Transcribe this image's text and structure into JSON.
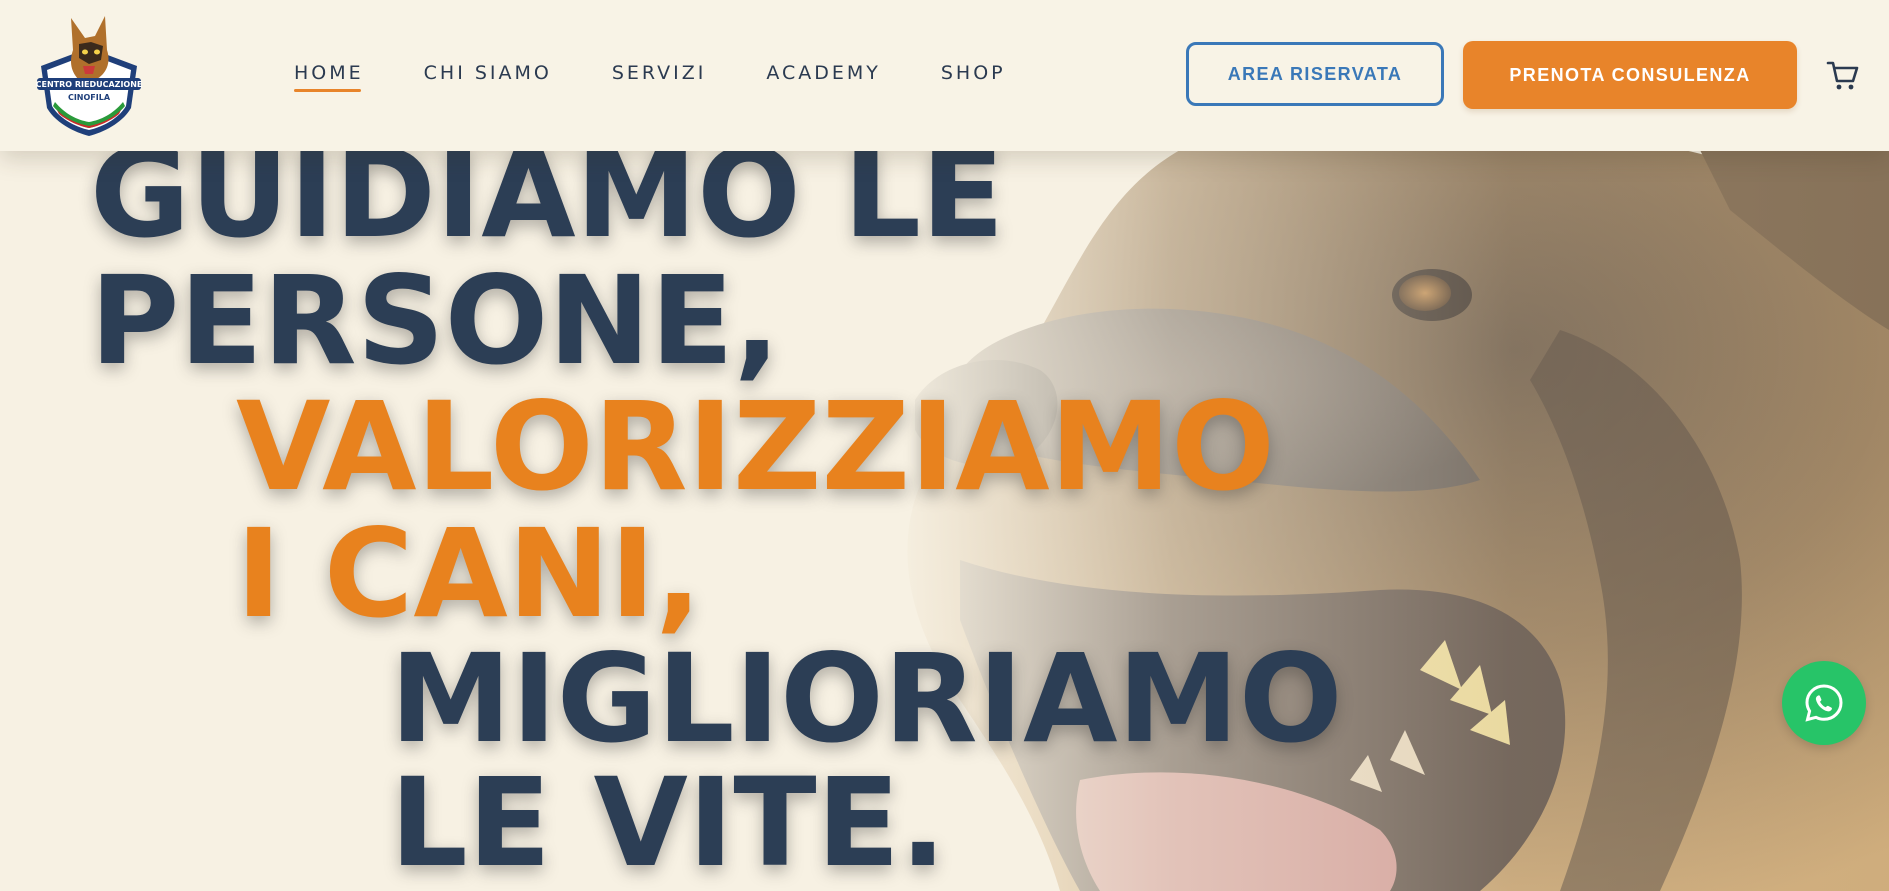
{
  "brand": {
    "logo_icon": "german-shepherd-shield-logo",
    "logo_text": "CENTRO RIEDUCAZIONE CINOFILA"
  },
  "nav": {
    "items": [
      {
        "label": "HOME",
        "active": true
      },
      {
        "label": "CHI SIAMO",
        "active": false
      },
      {
        "label": "SERVIZI",
        "active": false
      },
      {
        "label": "ACADEMY",
        "active": false
      },
      {
        "label": "SHOP",
        "active": false
      }
    ],
    "area_riservata": "AREA RISERVATA",
    "prenota": "PRENOTA CONSULENZA",
    "cart_icon": "shopping-cart-icon"
  },
  "hero": {
    "lines": [
      "GUIDIAMO LE",
      "PERSONE,",
      "VALORIZZIAMO",
      "I CANI,",
      "MIGLIORIAMO",
      "LE VITE."
    ],
    "background_icon": "german-shepherd-photo"
  },
  "floating": {
    "whatsapp_icon": "whatsapp-icon"
  },
  "colors": {
    "accent": "#e8842a",
    "navy": "#2c3e55",
    "outline_blue": "#3a78b8",
    "background": "#f7f1e3",
    "whatsapp": "#27c468"
  }
}
